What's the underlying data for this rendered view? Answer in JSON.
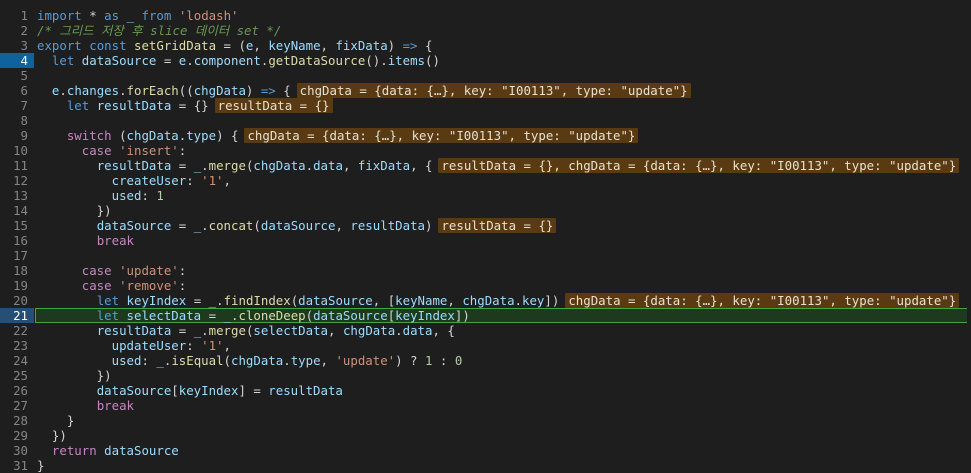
{
  "editor": {
    "current_line": 21,
    "breakpoint_line": 4,
    "lines": [
      {
        "n": "1",
        "tokens": [
          [
            "kw",
            "import"
          ],
          [
            "plain",
            " "
          ],
          [
            "op",
            "*"
          ],
          [
            "plain",
            " "
          ],
          [
            "kw",
            "as"
          ],
          [
            "plain",
            " "
          ],
          [
            "prop",
            "_"
          ],
          [
            "plain",
            " "
          ],
          [
            "kw",
            "from"
          ],
          [
            "plain",
            " "
          ],
          [
            "str",
            "'lodash'"
          ]
        ]
      },
      {
        "n": "2",
        "tokens": [
          [
            "cm",
            "/* 그리드 저장 후 slice 데이터 set */"
          ]
        ]
      },
      {
        "n": "3",
        "tokens": [
          [
            "kw",
            "export"
          ],
          [
            "plain",
            " "
          ],
          [
            "kw",
            "const"
          ],
          [
            "plain",
            " "
          ],
          [
            "fn",
            "setGridData"
          ],
          [
            "plain",
            " = ("
          ],
          [
            "prop",
            "e"
          ],
          [
            "plain",
            ", "
          ],
          [
            "prop",
            "keyName"
          ],
          [
            "plain",
            ", "
          ],
          [
            "prop",
            "fixData"
          ],
          [
            "plain",
            ") "
          ],
          [
            "kw",
            "=>"
          ],
          [
            "plain",
            " {"
          ]
        ]
      },
      {
        "n": "4",
        "tokens": [
          [
            "plain",
            "  "
          ],
          [
            "kw",
            "let"
          ],
          [
            "plain",
            " "
          ],
          [
            "prop",
            "dataSource"
          ],
          [
            "plain",
            " = "
          ],
          [
            "prop",
            "e"
          ],
          [
            "plain",
            "."
          ],
          [
            "prop",
            "component"
          ],
          [
            "plain",
            "."
          ],
          [
            "fn",
            "getDataSource"
          ],
          [
            "plain",
            "()."
          ],
          [
            "prop",
            "items"
          ],
          [
            "plain",
            "()"
          ]
        ]
      },
      {
        "n": "5",
        "tokens": []
      },
      {
        "n": "6",
        "tokens": [
          [
            "plain",
            "  "
          ],
          [
            "prop",
            "e"
          ],
          [
            "plain",
            "."
          ],
          [
            "prop",
            "changes"
          ],
          [
            "plain",
            "."
          ],
          [
            "fn",
            "forEach"
          ],
          [
            "plain",
            "(("
          ],
          [
            "prop",
            "chgData"
          ],
          [
            "plain",
            ") "
          ],
          [
            "kw",
            "=>"
          ],
          [
            "plain",
            " {"
          ]
        ],
        "inlay": "chgData = {data: {…}, key: \"I00113\", type: \"update\"}"
      },
      {
        "n": "7",
        "tokens": [
          [
            "plain",
            "    "
          ],
          [
            "kw",
            "let"
          ],
          [
            "plain",
            " "
          ],
          [
            "prop",
            "resultData"
          ],
          [
            "plain",
            " = {}"
          ]
        ],
        "inlay": "resultData = {}"
      },
      {
        "n": "8",
        "tokens": []
      },
      {
        "n": "9",
        "tokens": [
          [
            "plain",
            "    "
          ],
          [
            "kw2",
            "switch"
          ],
          [
            "plain",
            " ("
          ],
          [
            "prop",
            "chgData"
          ],
          [
            "plain",
            "."
          ],
          [
            "prop",
            "type"
          ],
          [
            "plain",
            ") {"
          ]
        ],
        "inlay": "chgData = {data: {…}, key: \"I00113\", type: \"update\"}"
      },
      {
        "n": "10",
        "tokens": [
          [
            "plain",
            "      "
          ],
          [
            "kw2",
            "case"
          ],
          [
            "plain",
            " "
          ],
          [
            "str",
            "'insert'"
          ],
          [
            "plain",
            ":"
          ]
        ]
      },
      {
        "n": "11",
        "tokens": [
          [
            "plain",
            "        "
          ],
          [
            "prop",
            "resultData"
          ],
          [
            "plain",
            " = "
          ],
          [
            "prop",
            "_"
          ],
          [
            "plain",
            "."
          ],
          [
            "fn",
            "merge"
          ],
          [
            "plain",
            "("
          ],
          [
            "prop",
            "chgData"
          ],
          [
            "plain",
            "."
          ],
          [
            "prop",
            "data"
          ],
          [
            "plain",
            ", "
          ],
          [
            "prop",
            "fixData"
          ],
          [
            "plain",
            ", {"
          ]
        ],
        "inlay": "resultData = {}, chgData = {data: {…}, key: \"I00113\", type: \"update\"}"
      },
      {
        "n": "12",
        "tokens": [
          [
            "plain",
            "          "
          ],
          [
            "prop",
            "createUser"
          ],
          [
            "plain",
            ": "
          ],
          [
            "str",
            "'1'"
          ],
          [
            "plain",
            ","
          ]
        ]
      },
      {
        "n": "13",
        "tokens": [
          [
            "plain",
            "          "
          ],
          [
            "prop",
            "used"
          ],
          [
            "plain",
            ": "
          ],
          [
            "num",
            "1"
          ]
        ]
      },
      {
        "n": "14",
        "tokens": [
          [
            "plain",
            "        })"
          ]
        ]
      },
      {
        "n": "15",
        "tokens": [
          [
            "plain",
            "        "
          ],
          [
            "prop",
            "dataSource"
          ],
          [
            "plain",
            " = "
          ],
          [
            "prop",
            "_"
          ],
          [
            "plain",
            "."
          ],
          [
            "fn",
            "concat"
          ],
          [
            "plain",
            "("
          ],
          [
            "prop",
            "dataSource"
          ],
          [
            "plain",
            ", "
          ],
          [
            "prop",
            "resultData"
          ],
          [
            "plain",
            ")"
          ]
        ],
        "inlay": "resultData = {}"
      },
      {
        "n": "16",
        "tokens": [
          [
            "plain",
            "        "
          ],
          [
            "kw2",
            "break"
          ]
        ]
      },
      {
        "n": "17",
        "tokens": []
      },
      {
        "n": "18",
        "tokens": [
          [
            "plain",
            "      "
          ],
          [
            "kw2",
            "case"
          ],
          [
            "plain",
            " "
          ],
          [
            "str",
            "'update'"
          ],
          [
            "plain",
            ":"
          ]
        ]
      },
      {
        "n": "19",
        "tokens": [
          [
            "plain",
            "      "
          ],
          [
            "kw2",
            "case"
          ],
          [
            "plain",
            " "
          ],
          [
            "str",
            "'remove'"
          ],
          [
            "plain",
            ":"
          ]
        ]
      },
      {
        "n": "20",
        "tokens": [
          [
            "plain",
            "        "
          ],
          [
            "kw",
            "let"
          ],
          [
            "plain",
            " "
          ],
          [
            "prop",
            "keyIndex"
          ],
          [
            "plain",
            " = "
          ],
          [
            "prop",
            "_"
          ],
          [
            "plain",
            "."
          ],
          [
            "fn",
            "findIndex"
          ],
          [
            "plain",
            "("
          ],
          [
            "prop",
            "dataSource"
          ],
          [
            "plain",
            ", ["
          ],
          [
            "prop",
            "keyName"
          ],
          [
            "plain",
            ", "
          ],
          [
            "prop",
            "chgData"
          ],
          [
            "plain",
            "."
          ],
          [
            "prop",
            "key"
          ],
          [
            "plain",
            "])"
          ]
        ],
        "inlay": "chgData = {data: {…}, key: \"I00113\", type: \"update\"}"
      },
      {
        "n": "21",
        "tokens": [
          [
            "plain",
            "        "
          ],
          [
            "kw",
            "let"
          ],
          [
            "plain",
            " "
          ],
          [
            "prop",
            "selectData"
          ],
          [
            "plain",
            " = "
          ],
          [
            "prop",
            "_"
          ],
          [
            "plain",
            "."
          ],
          [
            "fn",
            "cloneDeep"
          ],
          [
            "plain",
            "("
          ],
          [
            "prop",
            "dataSource"
          ],
          [
            "plain",
            "["
          ],
          [
            "prop",
            "keyIndex"
          ],
          [
            "plain",
            "])"
          ]
        ]
      },
      {
        "n": "22",
        "tokens": [
          [
            "plain",
            "        "
          ],
          [
            "prop",
            "resultData"
          ],
          [
            "plain",
            " = "
          ],
          [
            "prop",
            "_"
          ],
          [
            "plain",
            "."
          ],
          [
            "fn",
            "merge"
          ],
          [
            "plain",
            "("
          ],
          [
            "prop",
            "selectData"
          ],
          [
            "plain",
            ", "
          ],
          [
            "prop",
            "chgData"
          ],
          [
            "plain",
            "."
          ],
          [
            "prop",
            "data"
          ],
          [
            "plain",
            ", {"
          ]
        ]
      },
      {
        "n": "23",
        "tokens": [
          [
            "plain",
            "          "
          ],
          [
            "prop",
            "updateUser"
          ],
          [
            "plain",
            ": "
          ],
          [
            "str",
            "'1'"
          ],
          [
            "plain",
            ","
          ]
        ]
      },
      {
        "n": "24",
        "tokens": [
          [
            "plain",
            "          "
          ],
          [
            "prop",
            "used"
          ],
          [
            "plain",
            ": "
          ],
          [
            "prop",
            "_"
          ],
          [
            "plain",
            "."
          ],
          [
            "fn",
            "isEqual"
          ],
          [
            "plain",
            "("
          ],
          [
            "prop",
            "chgData"
          ],
          [
            "plain",
            "."
          ],
          [
            "prop",
            "type"
          ],
          [
            "plain",
            ", "
          ],
          [
            "str",
            "'update'"
          ],
          [
            "plain",
            ") ? "
          ],
          [
            "num",
            "1"
          ],
          [
            "plain",
            " : "
          ],
          [
            "num",
            "0"
          ]
        ]
      },
      {
        "n": "25",
        "tokens": [
          [
            "plain",
            "        })"
          ]
        ]
      },
      {
        "n": "26",
        "tokens": [
          [
            "plain",
            "        "
          ],
          [
            "prop",
            "dataSource"
          ],
          [
            "plain",
            "["
          ],
          [
            "prop",
            "keyIndex"
          ],
          [
            "plain",
            "] = "
          ],
          [
            "prop",
            "resultData"
          ]
        ]
      },
      {
        "n": "27",
        "tokens": [
          [
            "plain",
            "        "
          ],
          [
            "kw2",
            "break"
          ]
        ]
      },
      {
        "n": "28",
        "tokens": [
          [
            "plain",
            "    }"
          ]
        ]
      },
      {
        "n": "29",
        "tokens": [
          [
            "plain",
            "  })"
          ]
        ]
      },
      {
        "n": "30",
        "tokens": [
          [
            "plain",
            "  "
          ],
          [
            "kw2",
            "return"
          ],
          [
            "plain",
            " "
          ],
          [
            "prop",
            "dataSource"
          ]
        ]
      },
      {
        "n": "31",
        "tokens": [
          [
            "plain",
            "}"
          ]
        ]
      }
    ]
  }
}
